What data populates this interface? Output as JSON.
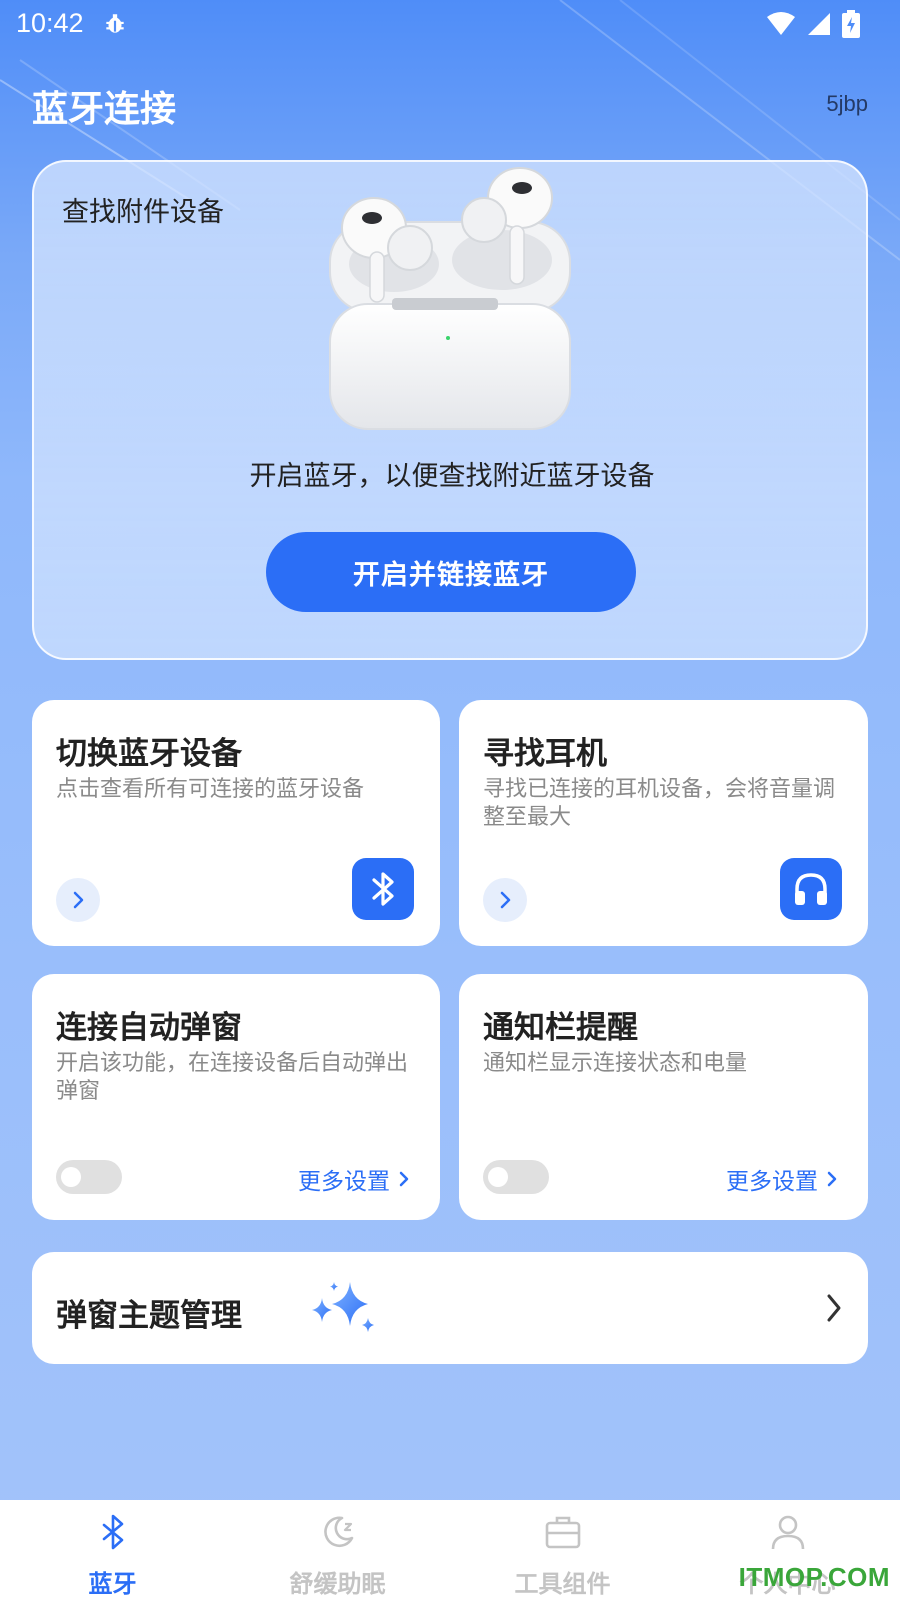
{
  "status_bar": {
    "time": "10:42",
    "icons": [
      "debug-icon",
      "wifi-icon",
      "cellular-icon",
      "battery-charging-icon"
    ]
  },
  "header": {
    "title": "蓝牙连接",
    "right_text": "5jbp"
  },
  "hero": {
    "label": "查找附件设备",
    "image": "earbuds-case-image",
    "description": "开启蓝牙，以便查找附近蓝牙设备",
    "button_label": "开启并链接蓝牙"
  },
  "cards": [
    {
      "title": "切换蓝牙设备",
      "description": "点击查看所有可连接的蓝牙设备",
      "icon": "bluetooth-icon"
    },
    {
      "title": "寻找耳机",
      "description": "寻找已连接的耳机设备，会将音量调整至最大",
      "icon": "headphones-icon"
    },
    {
      "title": "连接自动弹窗",
      "description": "开启该功能，在连接设备后自动弹出弹窗",
      "toggle_on": false,
      "more_label": "更多设置"
    },
    {
      "title": "通知栏提醒",
      "description": "通知栏显示连接状态和电量",
      "toggle_on": false,
      "more_label": "更多设置"
    }
  ],
  "theme": {
    "title": "弹窗主题管理",
    "icon": "sparkle-icon"
  },
  "bottom_nav": [
    {
      "label": "蓝牙",
      "icon": "bluetooth-icon",
      "active": true
    },
    {
      "label": "舒缓助眠",
      "icon": "moon-icon",
      "active": false
    },
    {
      "label": "工具组件",
      "icon": "briefcase-icon",
      "active": false
    },
    {
      "label": "个人中心",
      "icon": "person-icon",
      "active": false
    }
  ],
  "watermark": "ITMOP.COM",
  "colors": {
    "accent": "#2b6ef6",
    "watermark": "#3aa63a"
  }
}
